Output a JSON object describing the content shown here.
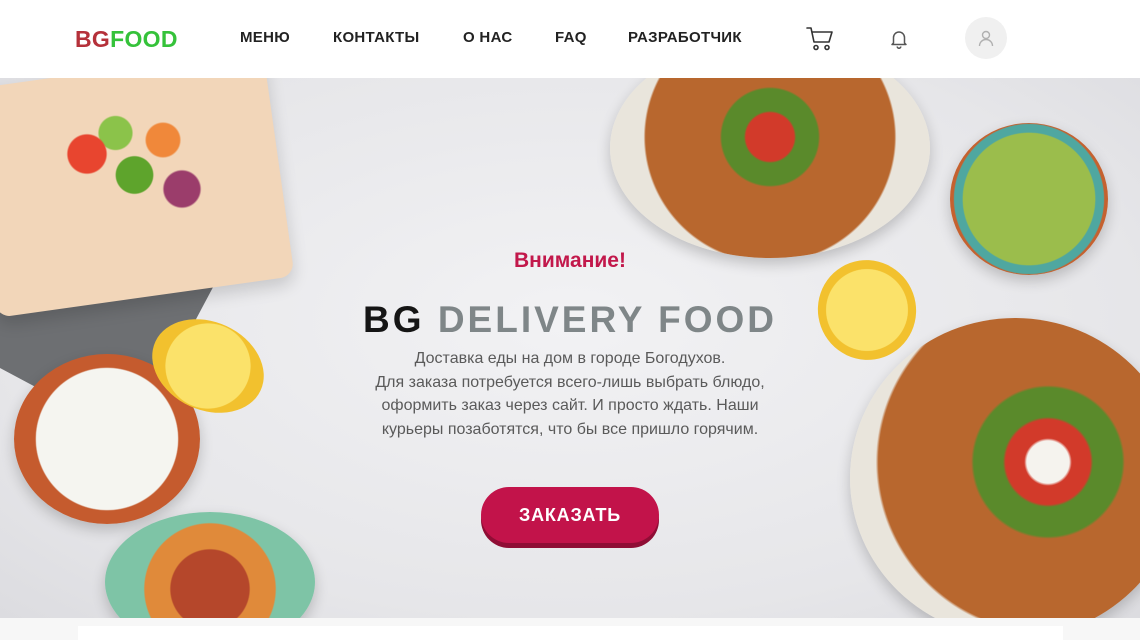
{
  "brand": {
    "logo_part1": "BG",
    "logo_part2": "FOOD",
    "color1": "#b5313a",
    "color2": "#35c23a"
  },
  "nav": {
    "items": [
      {
        "label": "МЕНЮ"
      },
      {
        "label": "КОНТАКТЫ"
      },
      {
        "label": "О НАС"
      },
      {
        "label": "FAQ"
      },
      {
        "label": "РАЗРАБОТЧИК"
      }
    ]
  },
  "header_icons": {
    "cart": "cart-icon",
    "bell": "bell-icon",
    "user": "user-icon"
  },
  "hero": {
    "attention": "Внимание!",
    "title_part1": "BG",
    "title_part2": "DELIVERY FOOD",
    "description_lines": [
      "Доставка еды на дом в городе Богодухов.",
      "Для заказа потребуется всего-лишь выбрать блюдо,",
      "оформить заказ через сайт. И просто ждать. Наши",
      "курьеры позаботятся, что бы все пришло горячим."
    ],
    "order_button": "ЗАКАЗАТЬ"
  },
  "colors": {
    "accent": "#c2134a",
    "attention": "#c2184b"
  }
}
